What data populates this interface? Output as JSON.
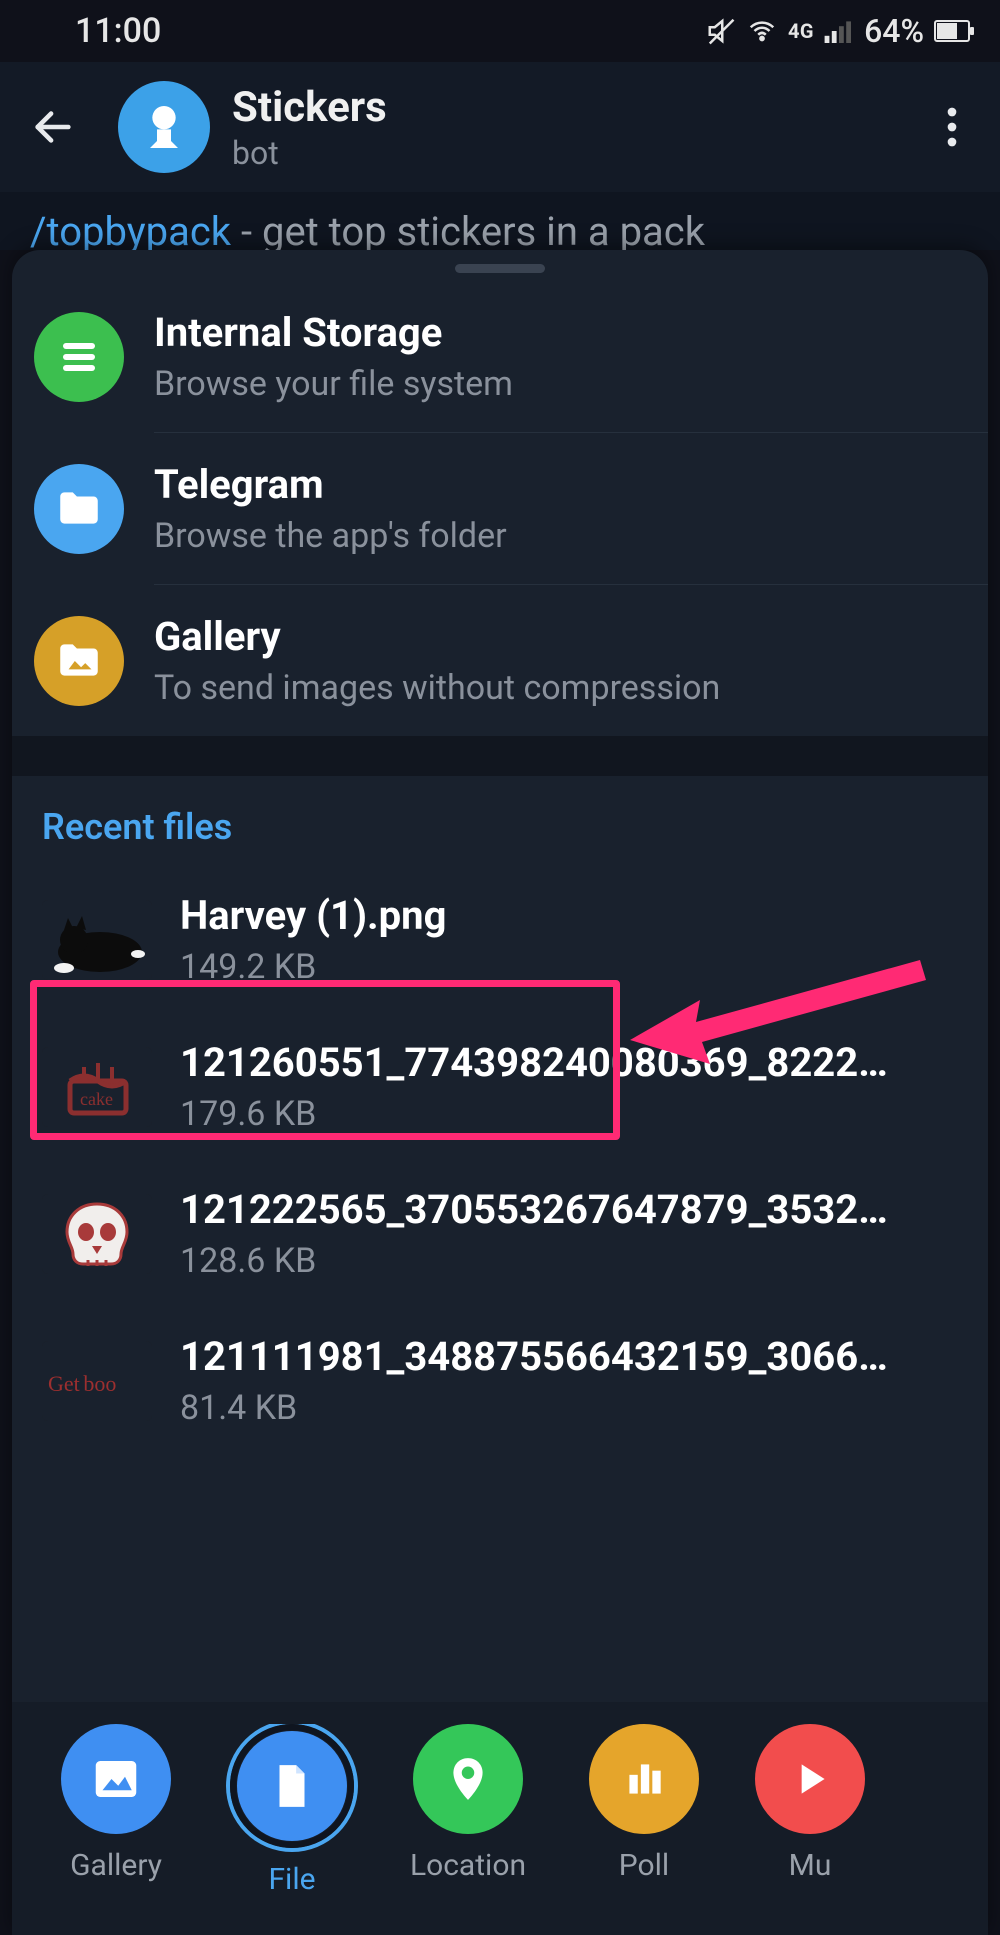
{
  "status": {
    "time": "11:00",
    "net_label": "4G",
    "battery_pct": "64%"
  },
  "header": {
    "title": "Stickers",
    "subtitle": "bot"
  },
  "peek": {
    "command": "/topbypack",
    "rest": " - get top stickers in a pack"
  },
  "sources": [
    {
      "title": "Internal Storage",
      "sub": "Browse your file system"
    },
    {
      "title": "Telegram",
      "sub": "Browse the app's folder"
    },
    {
      "title": "Gallery",
      "sub": "To send images without compression"
    }
  ],
  "recent_header": "Recent files",
  "files": [
    {
      "name": "Harvey (1).png",
      "size": "149.2 KB"
    },
    {
      "name": "121260551_774398240080369_8222…",
      "size": "179.6 KB"
    },
    {
      "name": "121222565_370553267647879_3532…",
      "size": "128.6 KB"
    },
    {
      "name": "121111981_348875566432159_3066…",
      "size": "81.4 KB"
    }
  ],
  "attach": [
    {
      "label": "Gallery"
    },
    {
      "label": "File"
    },
    {
      "label": "Location"
    },
    {
      "label": "Poll"
    },
    {
      "label": "Mu"
    }
  ]
}
